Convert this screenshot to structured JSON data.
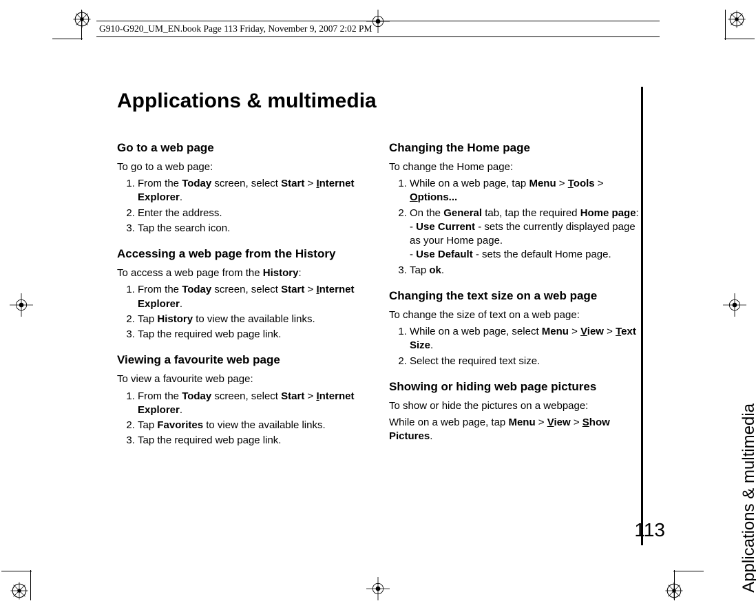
{
  "header": {
    "book_info": "G910-G920_UM_EN.book  Page 113  Friday, November 9, 2007  2:02 PM"
  },
  "main_title": "Applications & multimedia",
  "side_label": "Applications & multimedia",
  "page_number": "113",
  "col1": {
    "sec1": {
      "title": "Go to a web page",
      "intro": "To go to a web page:",
      "step1_a": "From the ",
      "step1_b": "Today",
      "step1_c": " screen, select ",
      "step1_d": "Start",
      "step1_e": " > ",
      "step1_f1": "I",
      "step1_f2": "nternet Explorer",
      "step1_g": ".",
      "step2": "Enter the address.",
      "step3": "Tap the search icon."
    },
    "sec2": {
      "title": "Accessing a web page from the History",
      "intro_a": "To access a web page from the ",
      "intro_b": "History",
      "intro_c": ":",
      "step1_a": "From the ",
      "step1_b": "Today",
      "step1_c": " screen, select ",
      "step1_d": "Start",
      "step1_e": " > ",
      "step1_f1": "I",
      "step1_f2": "nternet Explorer",
      "step1_g": ".",
      "step2_a": "Tap ",
      "step2_b": "History",
      "step2_c": " to view the available links.",
      "step3": "Tap the required web page link."
    },
    "sec3": {
      "title": "Viewing a favourite web page",
      "intro": "To view a favourite web page:",
      "step1_a": "From the ",
      "step1_b": "Today",
      "step1_c": " screen, select ",
      "step1_d": "Start",
      "step1_e": " > ",
      "step1_f1": "I",
      "step1_f2": "nternet Explorer",
      "step1_g": ".",
      "step2_a": "Tap ",
      "step2_b": "Favorites",
      "step2_c": " to view the available links.",
      "step3": "Tap the required web page link."
    }
  },
  "col2": {
    "sec1": {
      "title": "Changing the Home page",
      "intro": "To change the Home page:",
      "step1_a": "While on a web page, tap ",
      "step1_b": "Menu",
      "step1_c": " > ",
      "step1_d1": "T",
      "step1_d2": "ools",
      "step1_e": " > ",
      "step1_f1": "O",
      "step1_f2": "ptions...",
      "step2_a": "On the ",
      "step2_b": "General",
      "step2_c": " tab, tap the required ",
      "step2_d": "Home page",
      "step2_e": ":",
      "step2_sub1_a": "- ",
      "step2_sub1_b": "Use Current",
      "step2_sub1_c": " - sets the currently displayed page as your Home page.",
      "step2_sub2_a": "- ",
      "step2_sub2_b": "Use Default",
      "step2_sub2_c": " - sets the default Home page.",
      "step3_a": "Tap ",
      "step3_b": "ok",
      "step3_c": "."
    },
    "sec2": {
      "title": "Changing the text size on a web page",
      "intro": "To change the size of text on a web page:",
      "step1_a": "While on a web page, select ",
      "step1_b": "Menu",
      "step1_c": " > ",
      "step1_d1": "V",
      "step1_d2": "iew",
      "step1_e": " > ",
      "step1_f1": "T",
      "step1_f2": "ext Size",
      "step1_g": ".",
      "step2": "Select the required text size."
    },
    "sec3": {
      "title": "Showing or hiding web page pictures",
      "intro": "To show or hide the pictures on a webpage:",
      "body_a": "While on a web page, tap ",
      "body_b": "Menu",
      "body_c": " > ",
      "body_d1": "V",
      "body_d2": "iew",
      "body_e": " > ",
      "body_f1": "S",
      "body_f2": "how Pictures",
      "body_g": "."
    }
  }
}
